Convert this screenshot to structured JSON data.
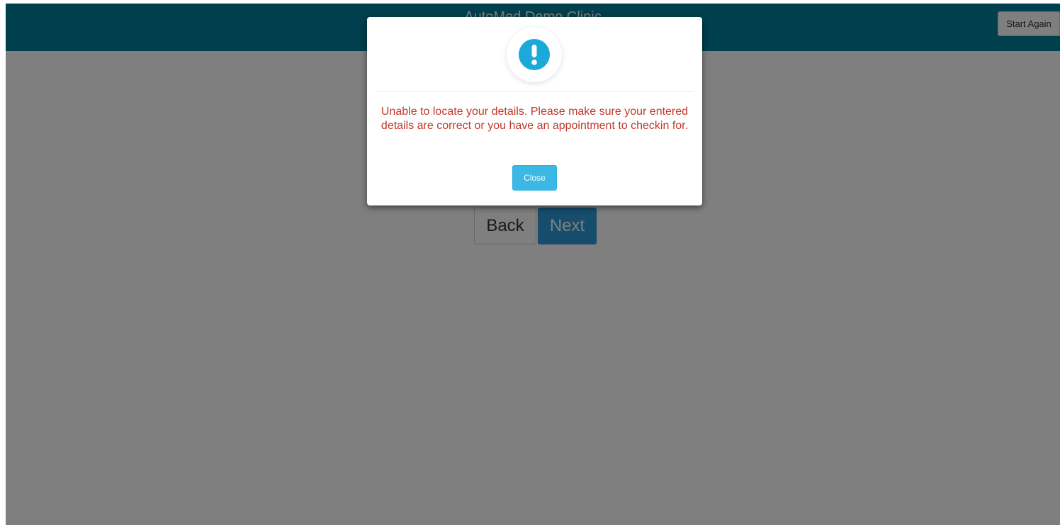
{
  "header": {
    "title": "AutoMed Demo Clinic",
    "start_again_label": "Start Again"
  },
  "navigation": {
    "back_label": "Back",
    "next_label": "Next"
  },
  "modal": {
    "icon": "exclamation-icon",
    "message": "Unable to locate your details. Please make sure your entered details are correct or you have an appointment to checkin for.",
    "close_label": "Close"
  },
  "colors": {
    "header": "#007e9a",
    "accent": "#2d9bd8",
    "error_text": "#c0392b",
    "info_icon": "#1aaad9"
  }
}
